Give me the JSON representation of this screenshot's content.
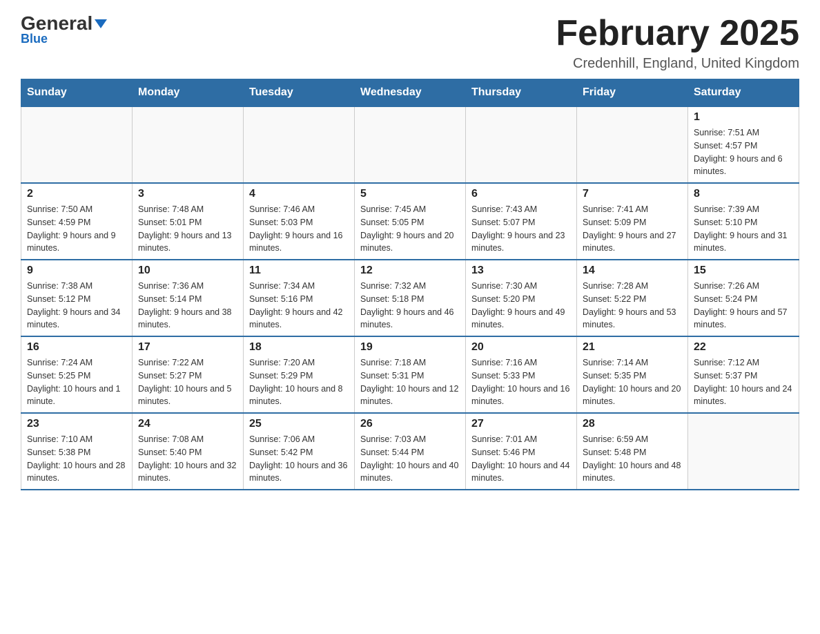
{
  "header": {
    "logo_main": "General",
    "logo_sub": "Blue",
    "month_title": "February 2025",
    "location": "Credenhill, England, United Kingdom"
  },
  "days_of_week": [
    "Sunday",
    "Monday",
    "Tuesday",
    "Wednesday",
    "Thursday",
    "Friday",
    "Saturday"
  ],
  "weeks": [
    [
      {
        "day": "",
        "info": ""
      },
      {
        "day": "",
        "info": ""
      },
      {
        "day": "",
        "info": ""
      },
      {
        "day": "",
        "info": ""
      },
      {
        "day": "",
        "info": ""
      },
      {
        "day": "",
        "info": ""
      },
      {
        "day": "1",
        "info": "Sunrise: 7:51 AM\nSunset: 4:57 PM\nDaylight: 9 hours and 6 minutes."
      }
    ],
    [
      {
        "day": "2",
        "info": "Sunrise: 7:50 AM\nSunset: 4:59 PM\nDaylight: 9 hours and 9 minutes."
      },
      {
        "day": "3",
        "info": "Sunrise: 7:48 AM\nSunset: 5:01 PM\nDaylight: 9 hours and 13 minutes."
      },
      {
        "day": "4",
        "info": "Sunrise: 7:46 AM\nSunset: 5:03 PM\nDaylight: 9 hours and 16 minutes."
      },
      {
        "day": "5",
        "info": "Sunrise: 7:45 AM\nSunset: 5:05 PM\nDaylight: 9 hours and 20 minutes."
      },
      {
        "day": "6",
        "info": "Sunrise: 7:43 AM\nSunset: 5:07 PM\nDaylight: 9 hours and 23 minutes."
      },
      {
        "day": "7",
        "info": "Sunrise: 7:41 AM\nSunset: 5:09 PM\nDaylight: 9 hours and 27 minutes."
      },
      {
        "day": "8",
        "info": "Sunrise: 7:39 AM\nSunset: 5:10 PM\nDaylight: 9 hours and 31 minutes."
      }
    ],
    [
      {
        "day": "9",
        "info": "Sunrise: 7:38 AM\nSunset: 5:12 PM\nDaylight: 9 hours and 34 minutes."
      },
      {
        "day": "10",
        "info": "Sunrise: 7:36 AM\nSunset: 5:14 PM\nDaylight: 9 hours and 38 minutes."
      },
      {
        "day": "11",
        "info": "Sunrise: 7:34 AM\nSunset: 5:16 PM\nDaylight: 9 hours and 42 minutes."
      },
      {
        "day": "12",
        "info": "Sunrise: 7:32 AM\nSunset: 5:18 PM\nDaylight: 9 hours and 46 minutes."
      },
      {
        "day": "13",
        "info": "Sunrise: 7:30 AM\nSunset: 5:20 PM\nDaylight: 9 hours and 49 minutes."
      },
      {
        "day": "14",
        "info": "Sunrise: 7:28 AM\nSunset: 5:22 PM\nDaylight: 9 hours and 53 minutes."
      },
      {
        "day": "15",
        "info": "Sunrise: 7:26 AM\nSunset: 5:24 PM\nDaylight: 9 hours and 57 minutes."
      }
    ],
    [
      {
        "day": "16",
        "info": "Sunrise: 7:24 AM\nSunset: 5:25 PM\nDaylight: 10 hours and 1 minute."
      },
      {
        "day": "17",
        "info": "Sunrise: 7:22 AM\nSunset: 5:27 PM\nDaylight: 10 hours and 5 minutes."
      },
      {
        "day": "18",
        "info": "Sunrise: 7:20 AM\nSunset: 5:29 PM\nDaylight: 10 hours and 8 minutes."
      },
      {
        "day": "19",
        "info": "Sunrise: 7:18 AM\nSunset: 5:31 PM\nDaylight: 10 hours and 12 minutes."
      },
      {
        "day": "20",
        "info": "Sunrise: 7:16 AM\nSunset: 5:33 PM\nDaylight: 10 hours and 16 minutes."
      },
      {
        "day": "21",
        "info": "Sunrise: 7:14 AM\nSunset: 5:35 PM\nDaylight: 10 hours and 20 minutes."
      },
      {
        "day": "22",
        "info": "Sunrise: 7:12 AM\nSunset: 5:37 PM\nDaylight: 10 hours and 24 minutes."
      }
    ],
    [
      {
        "day": "23",
        "info": "Sunrise: 7:10 AM\nSunset: 5:38 PM\nDaylight: 10 hours and 28 minutes."
      },
      {
        "day": "24",
        "info": "Sunrise: 7:08 AM\nSunset: 5:40 PM\nDaylight: 10 hours and 32 minutes."
      },
      {
        "day": "25",
        "info": "Sunrise: 7:06 AM\nSunset: 5:42 PM\nDaylight: 10 hours and 36 minutes."
      },
      {
        "day": "26",
        "info": "Sunrise: 7:03 AM\nSunset: 5:44 PM\nDaylight: 10 hours and 40 minutes."
      },
      {
        "day": "27",
        "info": "Sunrise: 7:01 AM\nSunset: 5:46 PM\nDaylight: 10 hours and 44 minutes."
      },
      {
        "day": "28",
        "info": "Sunrise: 6:59 AM\nSunset: 5:48 PM\nDaylight: 10 hours and 48 minutes."
      },
      {
        "day": "",
        "info": ""
      }
    ]
  ]
}
